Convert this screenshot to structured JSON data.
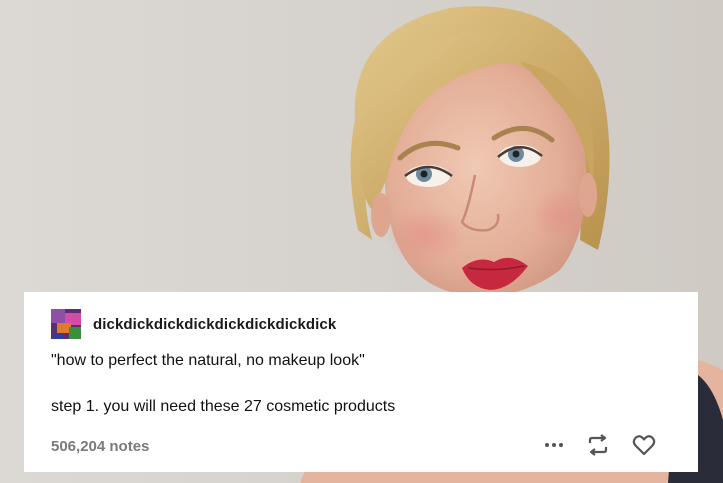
{
  "post": {
    "username": "dickdickdickdickdickdickdickdick",
    "line1": "\"how to perfect the natural, no makeup look\"",
    "line2": "step 1. you will need these 27 cosmetic products",
    "notes": "506,204 notes"
  },
  "icons": {
    "more": "more-options-icon",
    "reblog": "reblog-icon",
    "like": "heart-icon"
  },
  "colors": {
    "card_background": "#ffffff",
    "notes_text": "#7a7a7a",
    "icon_color": "#555555"
  }
}
